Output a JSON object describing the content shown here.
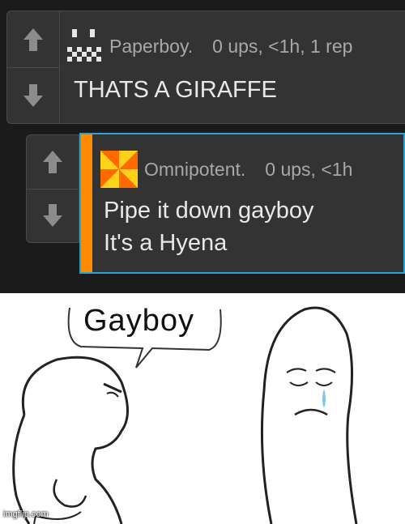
{
  "comment1": {
    "username": "Paperboy.",
    "stats": "0 ups, <1h, 1 rep",
    "text": "THATS A GIRAFFE"
  },
  "comment2": {
    "username": "Omnipotent.",
    "stats": "0 ups, <1h",
    "line1": "Pipe it down gayboy",
    "line2": "It's a Hyena"
  },
  "comic": {
    "speech": "Gayboy"
  },
  "watermark": "imgflip.com",
  "colors": {
    "background_dark": "#1b1b1b",
    "card": "#333333",
    "highlight_border": "#2aa3d0",
    "accent_bar": "#ff8c00",
    "tear": "#7fc6e8"
  }
}
